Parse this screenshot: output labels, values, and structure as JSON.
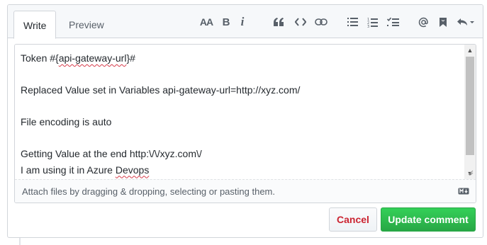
{
  "tabs": {
    "write": "Write",
    "preview": "Preview"
  },
  "toolbar": {
    "heading_label": "AA",
    "bold_label": "B",
    "italic_label": "i",
    "icons": [
      "text-size-icon",
      "bold-icon",
      "italic-icon",
      "quote-icon",
      "code-icon",
      "link-icon",
      "unordered-list-icon",
      "ordered-list-icon",
      "task-list-icon",
      "mention-icon",
      "bookmark-icon",
      "reply-icon",
      "chevron-down-icon"
    ]
  },
  "editor": {
    "lines": [
      {
        "before": "Token #{",
        "spell": "api-gateway-url",
        "after": "}#"
      },
      {
        "before": "",
        "spell": "",
        "after": ""
      },
      {
        "before": "Replaced Value set in Variables api-gateway-url=http://xyz.com/",
        "spell": "",
        "after": ""
      },
      {
        "before": "",
        "spell": "",
        "after": ""
      },
      {
        "before": "File encoding is auto",
        "spell": "",
        "after": ""
      },
      {
        "before": "",
        "spell": "",
        "after": ""
      },
      {
        "before": "Getting Value at the end http:\\/\\/xyz.com\\/",
        "spell": "",
        "after": ""
      },
      {
        "before": "I am using it in Azure ",
        "spell": "Devops",
        "after": ""
      }
    ],
    "drop_hint": "Attach files by dragging & dropping, selecting or pasting them."
  },
  "actions": {
    "cancel": "Cancel",
    "update": "Update comment"
  },
  "colors": {
    "accent_green": "#28a745",
    "cancel_red": "#cb2431",
    "border": "#d1d5da"
  }
}
